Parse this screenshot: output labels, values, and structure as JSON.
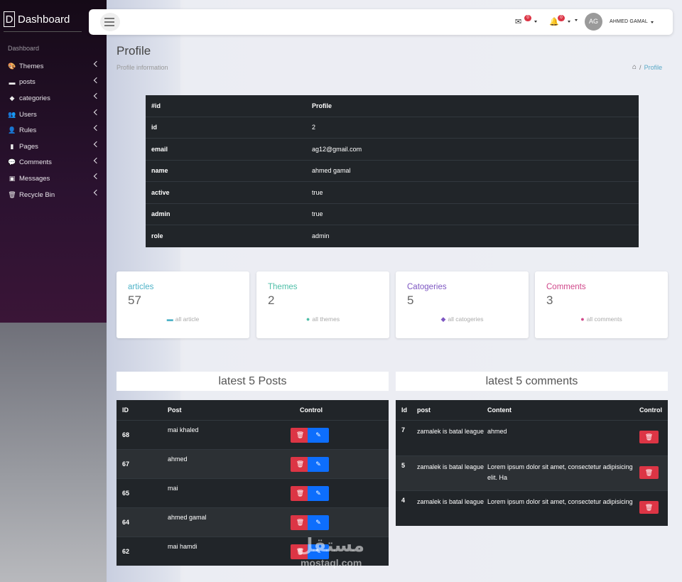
{
  "brand": {
    "letter": "D",
    "title": "Dashboard"
  },
  "sidebar": {
    "heading": "Dashboard",
    "items": [
      {
        "label": "Themes",
        "icon": "palette-icon",
        "glyph": "🎨"
      },
      {
        "label": "posts",
        "icon": "newspaper-icon",
        "glyph": "▬"
      },
      {
        "label": "categories",
        "icon": "tags-icon",
        "glyph": "◆"
      },
      {
        "label": "Users",
        "icon": "users-icon",
        "glyph": "👥"
      },
      {
        "label": "Rules",
        "icon": "user-icon",
        "glyph": "👤"
      },
      {
        "label": "Pages",
        "icon": "file-icon",
        "glyph": "▮"
      },
      {
        "label": "Comments",
        "icon": "comments-icon",
        "glyph": "💬"
      },
      {
        "label": "Messages",
        "icon": "id-card-icon",
        "glyph": "▣"
      },
      {
        "label": "Recycle Bin",
        "icon": "trash-icon",
        "glyph": "🗑"
      }
    ]
  },
  "topbar": {
    "mail_badge": "0",
    "bell_badge": "0",
    "avatar_initials": "AG",
    "user_name": "AHMED GAMAL"
  },
  "page": {
    "title": "Profile",
    "subtitle": "Profile information",
    "breadcrumb_current": "Profile"
  },
  "profile": {
    "head": {
      "key": "#id",
      "value": "Profile"
    },
    "rows": [
      {
        "key": "id",
        "value": "2"
      },
      {
        "key": "email",
        "value": "ag12@gmail.com"
      },
      {
        "key": "name",
        "value": "ahmed gamal"
      },
      {
        "key": "active",
        "value": "true"
      },
      {
        "key": "admin",
        "value": "true"
      },
      {
        "key": "role",
        "value": "admin"
      }
    ]
  },
  "cards": [
    {
      "title": "articles",
      "count": "57",
      "link": "all article",
      "color": "#4fb3c8",
      "icon": "newspaper-icon"
    },
    {
      "title": "Themes",
      "count": "2",
      "link": "all themes",
      "color": "#4fbfa8",
      "icon": "palette-icon"
    },
    {
      "title": "Catogeries",
      "count": "5",
      "link": "all catogeries",
      "color": "#7e57c2",
      "icon": "tags-icon"
    },
    {
      "title": "Comments",
      "count": "3",
      "link": "all comments",
      "color": "#d0478a",
      "icon": "comments-icon"
    }
  ],
  "posts": {
    "heading": "latest 5 Posts",
    "columns": [
      "ID",
      "Post",
      "Control"
    ],
    "rows": [
      {
        "id": "68",
        "post": "mai khaled"
      },
      {
        "id": "67",
        "post": "ahmed"
      },
      {
        "id": "65",
        "post": "mai"
      },
      {
        "id": "64",
        "post": "ahmed gamal"
      },
      {
        "id": "62",
        "post": "mai hamdi"
      }
    ]
  },
  "comments": {
    "heading": "latest 5 comments",
    "columns": [
      "Id",
      "post",
      "Content",
      "Control"
    ],
    "rows": [
      {
        "id": "7",
        "post": "zamalek is batal league",
        "content": "ahmed"
      },
      {
        "id": "5",
        "post": "zamalek is batal league",
        "content": "Lorem ipsum dolor sit amet, consectetur adipisicing elit. Ha"
      },
      {
        "id": "4",
        "post": "zamalek is batal league",
        "content": "Lorem ipsum dolor sit amet, consectetur adipisicing"
      }
    ]
  },
  "watermark": {
    "arabic": "مستقل",
    "latin": "mostaql.com"
  }
}
